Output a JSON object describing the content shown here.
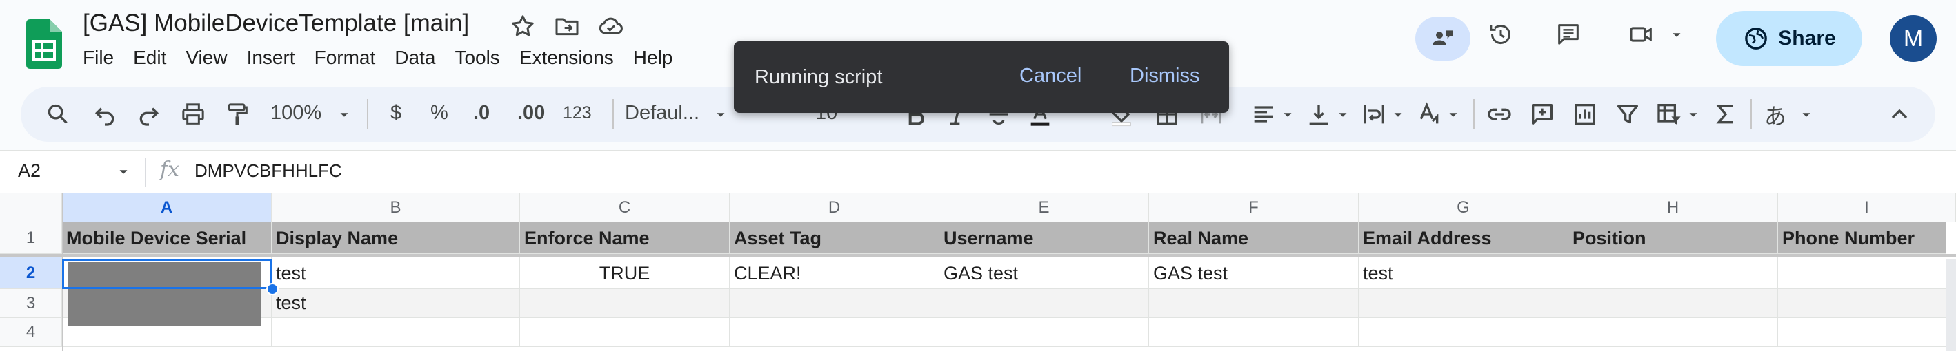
{
  "app": {
    "doc_title": "[GAS] MobileDeviceTemplate [main]",
    "menu": [
      "File",
      "Edit",
      "View",
      "Insert",
      "Format",
      "Data",
      "Tools",
      "Extensions",
      "Help"
    ],
    "share_label": "Share",
    "avatar_letter": "M",
    "brand_color": "#0f9d58",
    "accent_color": "#0b57d0"
  },
  "icons": {
    "title": [
      "star-icon",
      "move-to-folder-icon",
      "cloud-status-icon"
    ],
    "header_right": [
      "meet-present-icon",
      "version-history-icon",
      "comments-icon",
      "video-call-icon",
      "globe-icon"
    ]
  },
  "toolbar": {
    "zoom": "100%",
    "currency": "$",
    "percent": "%",
    "decrease_decimal": ".0",
    "increase_decimal": ".00",
    "number_format": "123",
    "font": "Defaul...",
    "font_size": "10",
    "input_tool": "あ"
  },
  "snackbar": {
    "message": "Running script",
    "cancel": "Cancel",
    "dismiss": "Dismiss"
  },
  "formula_bar": {
    "name_box": "A2",
    "fx": "fx",
    "value": "DMPVCBFHHLFC"
  },
  "grid": {
    "columns": [
      "A",
      "B",
      "C",
      "D",
      "E",
      "F",
      "G",
      "H",
      "I"
    ],
    "selected_column": "A",
    "row_numbers": [
      "1",
      "2",
      "3",
      "4"
    ],
    "selected_row": "2",
    "headers": [
      "Mobile Device Serial",
      "Display Name",
      "Enforce Name",
      "Asset Tag",
      "Username",
      "Real Name",
      "Email Address",
      "Position",
      "Phone Number"
    ],
    "rows": [
      [
        "",
        "test",
        "TRUE",
        "CLEAR!",
        "GAS test",
        "GAS test",
        "test",
        "",
        ""
      ],
      [
        "",
        "test",
        "",
        "",
        "",
        "",
        "",
        "",
        ""
      ],
      [
        "",
        "",
        "",
        "",
        "",
        "",
        "",
        "",
        ""
      ]
    ]
  }
}
